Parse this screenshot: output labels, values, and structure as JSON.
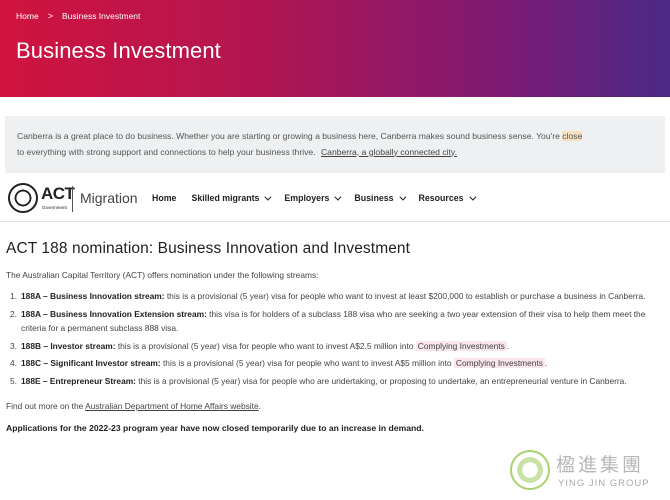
{
  "breadcrumb": {
    "home": "Home",
    "separator": ">",
    "current": "Business Investment"
  },
  "hero": {
    "title": "Business Investment"
  },
  "intro": {
    "text_part1": "Canberra is a great place to do business. Whether you are starting or growing a business here, Canberra makes sound business sense. You're ",
    "highlight": "close",
    "text_part2": "to everything with strong support and connections to help your business thrive.",
    "link": "Canberra, a globally connected  city."
  },
  "logo": {
    "act": "ACT",
    "government": "Government",
    "section": "Migration"
  },
  "nav": {
    "items": [
      {
        "label": "Home",
        "dropdown": false
      },
      {
        "label": "Skilled migrants",
        "dropdown": true
      },
      {
        "label": "Employers",
        "dropdown": true
      },
      {
        "label": "Business",
        "dropdown": true
      },
      {
        "label": "Resources",
        "dropdown": true
      }
    ]
  },
  "main": {
    "title": "ACT 188 nomination: Business Innovation and Investment",
    "lead": "The Australian Capital Territory (ACT) offers nomination under the following streams:",
    "streams": [
      {
        "num": "1.",
        "name": "188A – Business Innovation stream:",
        "text": " this is a provisional (5 year) visa for people who want to invest at least $200,000 to establish or purchase a business in Canberra.",
        "link": "",
        "after": ""
      },
      {
        "num": "2.",
        "name": "188A – Business Innovation Extension stream:",
        "text": " this visa is for holders of a subclass 188 visa who are seeking a two year extension of their visa to help them meet the criteria for a permanent subclass 888 visa.",
        "link": "",
        "after": ""
      },
      {
        "num": "3.",
        "name": "188B – Investor stream:",
        "text": " this is a provisional (5 year) visa for people who want to invest A$2.5 million into ",
        "link": "Complying Investments",
        "after": "."
      },
      {
        "num": "4.",
        "name": "188C – Significant Investor stream:",
        "text": " this is a provisional (5 year) visa for people who want to invest A$5 million into ",
        "link": "Complying Investments",
        "after": "."
      },
      {
        "num": "5.",
        "name": "188E – Entrepreneur Stream:",
        "text": " this is a provisional (5 year) visa for people who are undertaking, or proposing to undertake, an entrepreneurial venture in Canberra.",
        "link": "",
        "after": ""
      }
    ],
    "findout_prefix": "Find out more on the ",
    "findout_link": "Australian Department of Home Affairs website",
    "findout_suffix": ".",
    "closed_notice": "Applications for the 2022-23 program year have now closed temporarily due to an increase in demand."
  },
  "watermark": {
    "chinese": "楹進集團",
    "english": "YING JIN GROUP"
  },
  "colors": {
    "hero_start": "#d0143f",
    "hero_end": "#4a2a86",
    "link_highlight": "#f9e6ee",
    "word_highlight": "#f6e1c1"
  }
}
